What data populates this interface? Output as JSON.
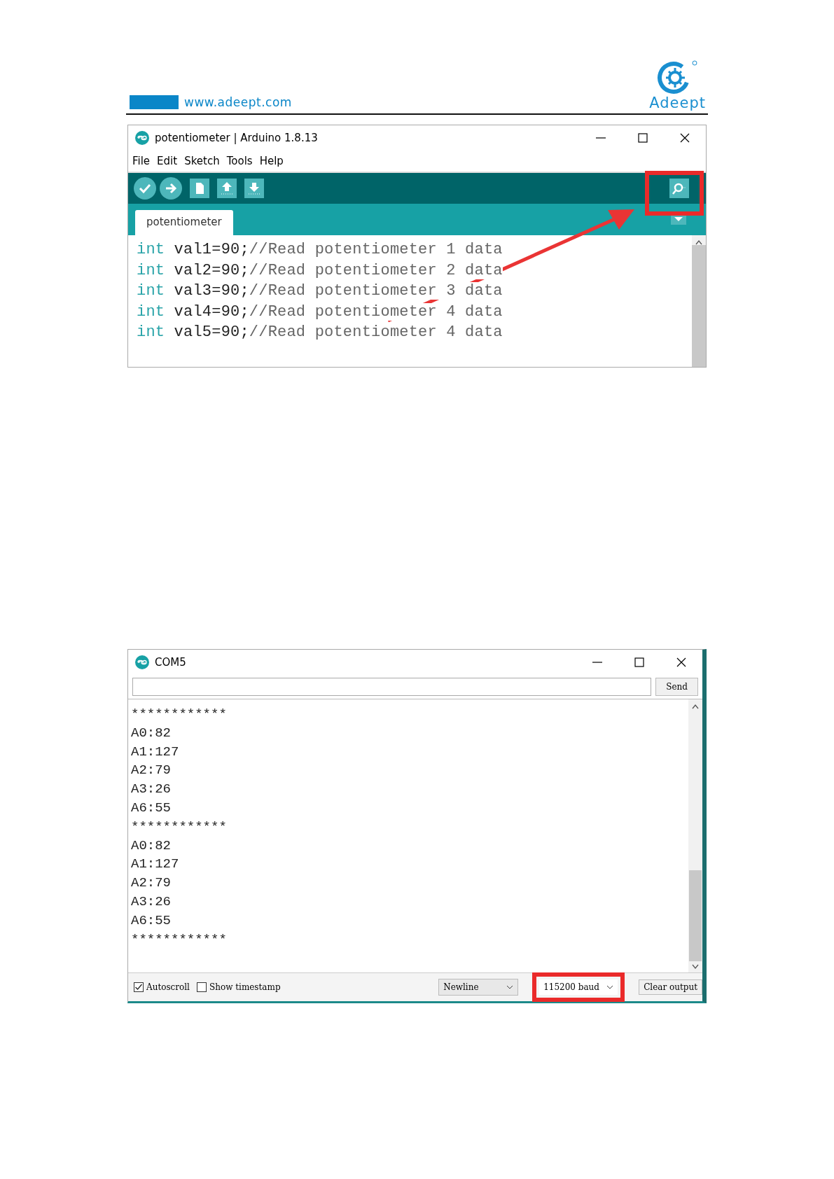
{
  "header": {
    "url": "www.adeept.com",
    "brand": "Adeept"
  },
  "ide": {
    "title": "potentiometer | Arduino 1.8.13",
    "menu": [
      "File",
      "Edit",
      "Sketch",
      "Tools",
      "Help"
    ],
    "tabs": [
      {
        "label": "potentiometer",
        "selected": true
      }
    ],
    "code": [
      {
        "keyword": "int",
        "code": " val1=90;",
        "comment": "//Read potentiometer 1 data"
      },
      {
        "keyword": "int",
        "code": " val2=90;",
        "comment": "//Read potentiometer 2 data"
      },
      {
        "keyword": "int",
        "code": " val3=90;",
        "comment": "//Read potentiometer 3 data"
      },
      {
        "keyword": "int",
        "code": " val4=90;",
        "comment": "//Read potentiometer 4 data"
      },
      {
        "keyword": "int",
        "code": " val5=90;",
        "comment": "//Read potentiometer 4 data"
      }
    ]
  },
  "serial": {
    "title": "COM5",
    "send": "Send",
    "output": [
      "************",
      "A0:82",
      "A1:127",
      "A2:79",
      "A3:26",
      "A6:55",
      "************",
      "A0:82",
      "A1:127",
      "A2:79",
      "A3:26",
      "A6:55",
      "************"
    ],
    "autoscroll": {
      "label": "Autoscroll",
      "checked": true
    },
    "timestamp": {
      "label": "Show timestamp",
      "checked": false
    },
    "line_ending": "Newline",
    "baud": "115200 baud",
    "clear": "Clear output"
  }
}
